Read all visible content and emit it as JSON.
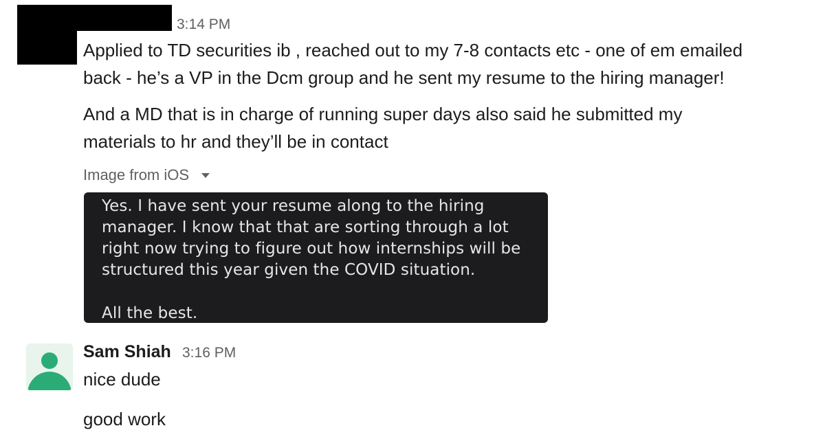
{
  "messages": [
    {
      "time": "3:14 PM",
      "lines": [
        "Applied to TD securities ib , reached out to my 7-8 contacts etc - one of em emailed",
        "back - he’s a VP in the Dcm group and he sent my resume to the hiring manager!"
      ]
    },
    {
      "lines": [
        "And a MD that is in charge of running super days also said he submitted my",
        "materials to hr and they’ll be in contact"
      ]
    }
  ],
  "attachment": {
    "label": "Image from iOS",
    "lines": [
      "Yes. I have sent your resume along to the hiring",
      "manager. I know that that are sorting through a lot",
      "right now trying to figure out how internships will be",
      "structured this year given the COVID situation."
    ],
    "signoff": "All the best."
  },
  "reply": {
    "author": "Sam Shiah",
    "time": "3:16 PM",
    "avatar_icon": "user-icon",
    "avatar_color": "#2bac76",
    "messages": [
      "nice dude",
      "good work"
    ]
  }
}
